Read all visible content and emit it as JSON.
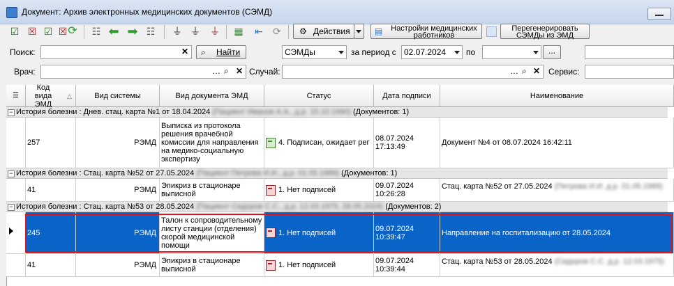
{
  "window": {
    "title": "Документ: Архив электронных медицинских документов (СЭМД)"
  },
  "toolbar": {
    "actions_label": "Действия",
    "settings_label": "Настройки медицинских работников",
    "regen_label": "Перегенерировать СЭМДы из ЭМД"
  },
  "filters": {
    "search_label": "Поиск:",
    "search_value": "",
    "find_button": "Найти",
    "type_value": "СЭМДы",
    "period_label": "за период с",
    "date_from": "02.07.2024",
    "to_label": "по",
    "date_to": "",
    "doctor_label": "Врач:",
    "doctor_value": "",
    "case_label": "Случай:",
    "case_value": "",
    "service_label": "Сервис:"
  },
  "columns": [
    "Код вида ЭМД",
    "Вид системы",
    "Вид документа ЭМД",
    "Статус",
    "Дата подписи",
    "Наименование"
  ],
  "groups": [
    {
      "title": "История болезни : Днев. стац. карта №1 от 18.04.2024",
      "hidden": "(Пациент Иванов А.А., д.р. 15.10.1990)",
      "count": "(Документов: 1)",
      "rows": [
        {
          "code": "257",
          "system": "РЭМД",
          "doc_type": "Выписка из протокола решения врачебной комиссии для направления на медико-социальную экспертизу",
          "status": "4. Подписан, ожидает рег",
          "status_ok": true,
          "date": "08.07.2024 17:13:49",
          "name": "Документ №4 от 08.07.2024 16:42:11",
          "name_hidden": ""
        }
      ]
    },
    {
      "title": "История болезни : Стац. карта №52 от 27.05.2024",
      "hidden": "(Пациент Петрова И.И., д.р. 01.05.1989)",
      "count": "(Документов: 1)",
      "rows": [
        {
          "code": "41",
          "system": "РЭМД",
          "doc_type": "Эпикриз в стационаре выписной",
          "status": "1. Нет подписей",
          "status_ok": false,
          "date": "09.07.2024 10:26:28",
          "name": "Стац. карта №52 от 27.05.2024",
          "name_hidden": "(Петрова И.И. д.р. 01.05.1989)"
        }
      ]
    },
    {
      "title": "История болезни : Стац. карта №53 от 28.05.2024",
      "hidden": "(Пациент Сидоров С.С., д.р. 12.03.1975, 28.05.2024)",
      "count": "(Документов: 2)",
      "rows": [
        {
          "code": "245",
          "system": "РЭМД",
          "doc_type": "Талон к сопроводительному листу станции (отделения) скорой медицинской помощи",
          "status": "1. Нет подписей",
          "status_ok": false,
          "date": "09.07.2024 10:39:47",
          "name": "Направление на госпитализацию от 28.05.2024",
          "name_hidden": ""
        },
        {
          "code": "41",
          "system": "РЭМД",
          "doc_type": "Эпикриз в стационаре выписной",
          "status": "1. Нет подписей",
          "status_ok": false,
          "date": "09.07.2024 10:39:44",
          "name": "Стац. карта №53 от 28.05.2024",
          "name_hidden": "(Сидоров С.С. д.р. 12.03.1975)"
        }
      ]
    }
  ],
  "colors": {
    "selection": "#0a64c8",
    "outline": "#e2141c"
  }
}
